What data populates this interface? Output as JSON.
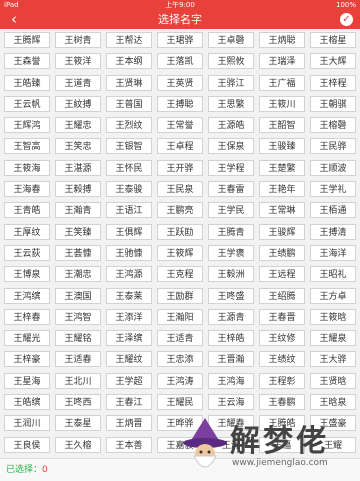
{
  "status_bar": {
    "carrier": "iPad",
    "time": "上午9:00",
    "battery": "100%"
  },
  "header": {
    "title": "选择名字",
    "back_icon": "chevron-left-icon",
    "confirm_icon": "check-icon"
  },
  "names": [
    "王腾辉",
    "王树青",
    "王帮达",
    "王珺骅",
    "王卓磬",
    "王炳聪",
    "王榕星",
    "王森誉",
    "王筱洋",
    "王本纲",
    "王落凯",
    "王熙攸",
    "王瑞泽",
    "王大辉",
    "王皓臻",
    "王道青",
    "王贤琳",
    "王英贤",
    "王骅江",
    "王广福",
    "王梓程",
    "王云帆",
    "王紋搏",
    "王普国",
    "王搏聪",
    "王思繁",
    "王筱川",
    "王朝骐",
    "王辉鸿",
    "王耀忠",
    "王烈纹",
    "王常誉",
    "王源皓",
    "王韶智",
    "王榕磬",
    "王智高",
    "王笑忠",
    "王银智",
    "王卓程",
    "王保泉",
    "王骏臻",
    "王民骅",
    "王筱海",
    "王湛源",
    "王怀民",
    "王开骅",
    "王学程",
    "王楚繁",
    "王顺波",
    "王海春",
    "王毅搏",
    "王泰骏",
    "王民泉",
    "王春雷",
    "王艳年",
    "王学礼",
    "王青皓",
    "王瀚青",
    "王语江",
    "王鹏亮",
    "王学民",
    "王常琳",
    "王栢通",
    "王厚纹",
    "王笑臻",
    "王俱辉",
    "王跃劻",
    "王腾青",
    "王骏辉",
    "王搏清",
    "王云荻",
    "王荟慷",
    "王驰慷",
    "王筱辉",
    "王学褒",
    "王绩鹏",
    "王海洋",
    "王博泉",
    "王潮忠",
    "王鸿源",
    "王克程",
    "王毅洲",
    "王远程",
    "王昭礼",
    "王鸿缤",
    "王澳国",
    "王泰莱",
    "王励群",
    "王咚盛",
    "王绍腾",
    "王方卓",
    "王梓春",
    "王鸿智",
    "王添洋",
    "王瀚阳",
    "王源青",
    "王春晋",
    "王筱晗",
    "王耀光",
    "王耀铭",
    "王泽缤",
    "王适青",
    "王梓皓",
    "王纹修",
    "王耀泉",
    "王梓豪",
    "王适春",
    "王耀纹",
    "王忠添",
    "王晋瀚",
    "王绩纹",
    "王大骅",
    "王星海",
    "王北川",
    "王学超",
    "王鸿涛",
    "王鸿海",
    "王程彰",
    "王贤晗",
    "王皓缤",
    "王咚西",
    "王春江",
    "王耀民",
    "王云海",
    "王春鹏",
    "王晗泉",
    "王润川",
    "王泰星",
    "王炳晋",
    "王晔骅",
    "王耀春",
    "王腾皓",
    "王盛豪",
    "王良侯",
    "王久榕",
    "王本善",
    "王嘉骏",
    "王瀚",
    "王福",
    "王耀"
  ],
  "footer": {
    "selected_label": "已选择：",
    "selected_count": "0"
  },
  "watermark": {
    "text": "解梦佬",
    "url": "www.jiemenglao.com"
  },
  "colors": {
    "accent": "#e8413c",
    "label_green": "#2bb24c"
  }
}
